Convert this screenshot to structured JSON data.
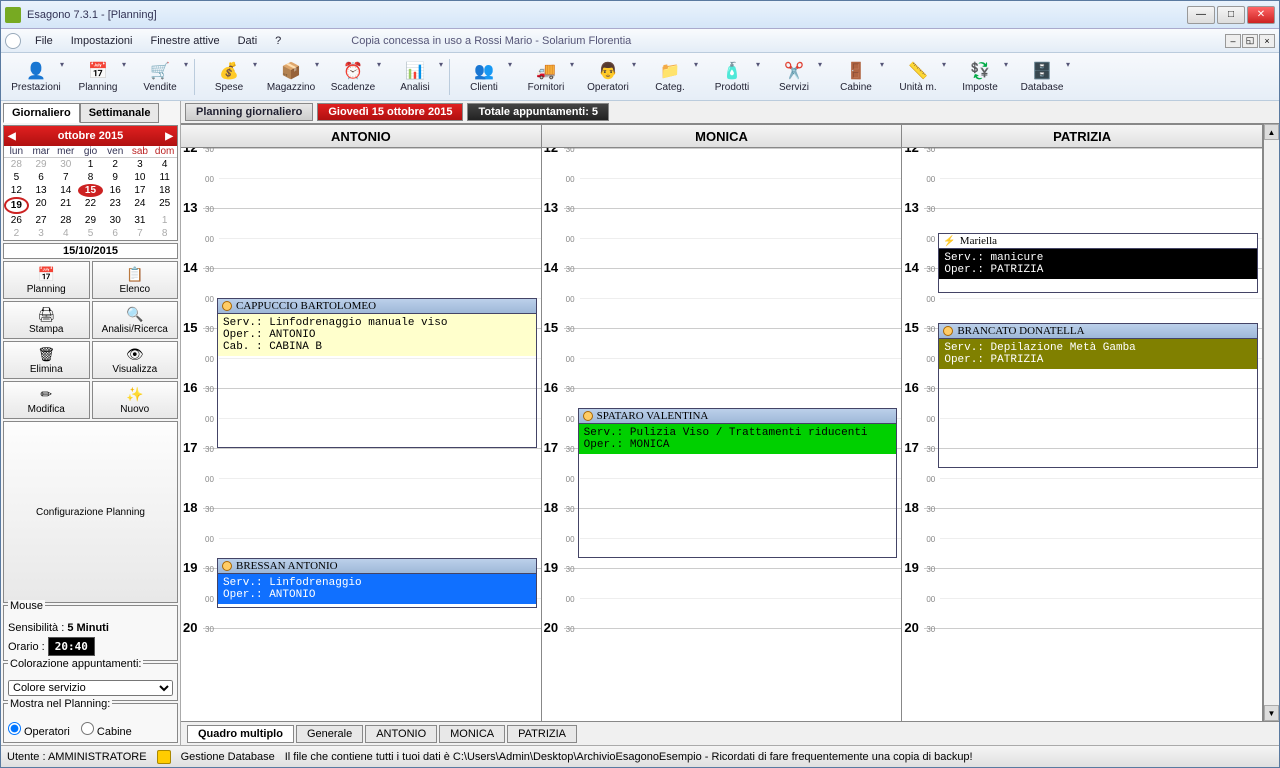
{
  "window": {
    "title": "Esagono 7.3.1 - [Planning]"
  },
  "menu": {
    "items": [
      "File",
      "Impostazioni",
      "Finestre attive",
      "Dati",
      "?"
    ],
    "license": "Copia concessa in uso a Rossi Mario - Solarium Florentia"
  },
  "toolbar": [
    {
      "label": "Prestazioni",
      "icon": "👤"
    },
    {
      "label": "Planning",
      "icon": "📅"
    },
    {
      "label": "Vendite",
      "icon": "🛒"
    },
    {
      "label": "Spese",
      "icon": "💰"
    },
    {
      "label": "Magazzino",
      "icon": "📦"
    },
    {
      "label": "Scadenze",
      "icon": "⏰"
    },
    {
      "label": "Analisi",
      "icon": "📊"
    },
    {
      "label": "Clienti",
      "icon": "👥"
    },
    {
      "label": "Fornitori",
      "icon": "🚚"
    },
    {
      "label": "Operatori",
      "icon": "👨"
    },
    {
      "label": "Categ.",
      "icon": "📁"
    },
    {
      "label": "Prodotti",
      "icon": "🧴"
    },
    {
      "label": "Servizi",
      "icon": "✂️"
    },
    {
      "label": "Cabine",
      "icon": "🚪"
    },
    {
      "label": "Unità m.",
      "icon": "📏"
    },
    {
      "label": "Imposte",
      "icon": "💱"
    },
    {
      "label": "Database",
      "icon": "🗄️"
    }
  ],
  "sidebar": {
    "tabs": {
      "daily": "Giornaliero",
      "weekly": "Settimanale"
    },
    "calendar": {
      "title": "ottobre 2015",
      "dow": [
        "lun",
        "mar",
        "mer",
        "gio",
        "ven",
        "sab",
        "dom"
      ],
      "prevmonth": [
        28,
        29,
        30
      ],
      "days": [
        1,
        2,
        3,
        4,
        5,
        6,
        7,
        8,
        9,
        10,
        11,
        12,
        13,
        14,
        15,
        16,
        17,
        18,
        19,
        20,
        21,
        22,
        23,
        24,
        25,
        26,
        27,
        28,
        29,
        30,
        31
      ],
      "nextmonth": [
        1,
        2,
        3,
        4,
        5,
        6,
        7,
        8
      ],
      "selected": 15,
      "today": 19
    },
    "date_display": "15/10/2015",
    "actions": {
      "planning": "Planning",
      "elenco": "Elenco",
      "stampa": "Stampa",
      "analisi": "Analisi/Ricerca",
      "elimina": "Elimina",
      "visualizza": "Visualizza",
      "modifica": "Modifica",
      "nuovo": "Nuovo",
      "config": "Configurazione Planning"
    },
    "mouse": {
      "title": "Mouse",
      "sens_label": "Sensibilità :",
      "sens_value": "5 Minuti",
      "time_label": "Orario :",
      "time_value": "20:40"
    },
    "coloring": {
      "title": "Colorazione appuntamenti:",
      "value": "Colore servizio"
    },
    "show": {
      "title": "Mostra nel Planning:",
      "opt1": "Operatori",
      "opt2": "Cabine"
    }
  },
  "info": {
    "planning": "Planning giornaliero",
    "date": "Giovedì 15 ottobre 2015",
    "count": "Totale appuntamenti: 5"
  },
  "columns": [
    "ANTONIO",
    "MONICA",
    "PATRIZIA"
  ],
  "hours": [
    12,
    13,
    14,
    15,
    16,
    17,
    18,
    19,
    20
  ],
  "appointments": {
    "antonio": [
      {
        "name": "CAPPUCCIO BARTOLOMEO",
        "serv": "Serv.: Linfodrenaggio manuale viso",
        "oper": "Oper.: ANTONIO",
        "cab": "Cab. : CABINA B"
      },
      {
        "name": "BRESSAN ANTONIO",
        "serv": "Serv.: Linfodrenaggio",
        "oper": "Oper.: ANTONIO"
      }
    ],
    "monica": [
      {
        "name": "SPATARO VALENTINA",
        "serv": "Serv.: Pulizia Viso / Trattamenti riducenti",
        "oper": "Oper.: MONICA"
      }
    ],
    "patrizia": [
      {
        "name": "Mariella",
        "serv": "Serv.: manicure",
        "oper": "Oper.: PATRIZIA"
      },
      {
        "name": "BRANCATO DONATELLA",
        "serv": "Serv.: Depilazione Metà Gamba",
        "oper": "Oper.: PATRIZIA"
      }
    ]
  },
  "bottom_tabs": [
    "Quadro multiplo",
    "Generale",
    "ANTONIO",
    "MONICA",
    "PATRIZIA"
  ],
  "status": {
    "user": "Utente : AMMINISTRATORE",
    "db": "Gestione Database",
    "msg": "Il file che contiene tutti i tuoi dati è C:\\Users\\Admin\\Desktop\\ArchivioEsagonoEsempio - Ricordati di fare frequentemente una copia di backup!"
  }
}
